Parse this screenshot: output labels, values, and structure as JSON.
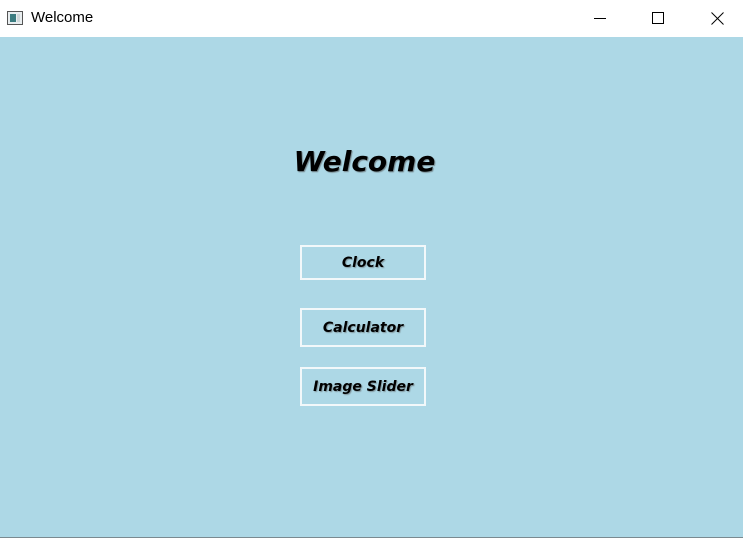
{
  "window": {
    "title": "Welcome",
    "controls": {
      "minimize_icon": "minimize-icon",
      "maximize_icon": "maximize-icon",
      "close_icon": "close-icon"
    }
  },
  "main": {
    "heading": "Welcome",
    "background_color": "#add8e6",
    "buttons": [
      {
        "label": "Clock"
      },
      {
        "label": "Calculator"
      },
      {
        "label": "Image Slider"
      }
    ]
  }
}
